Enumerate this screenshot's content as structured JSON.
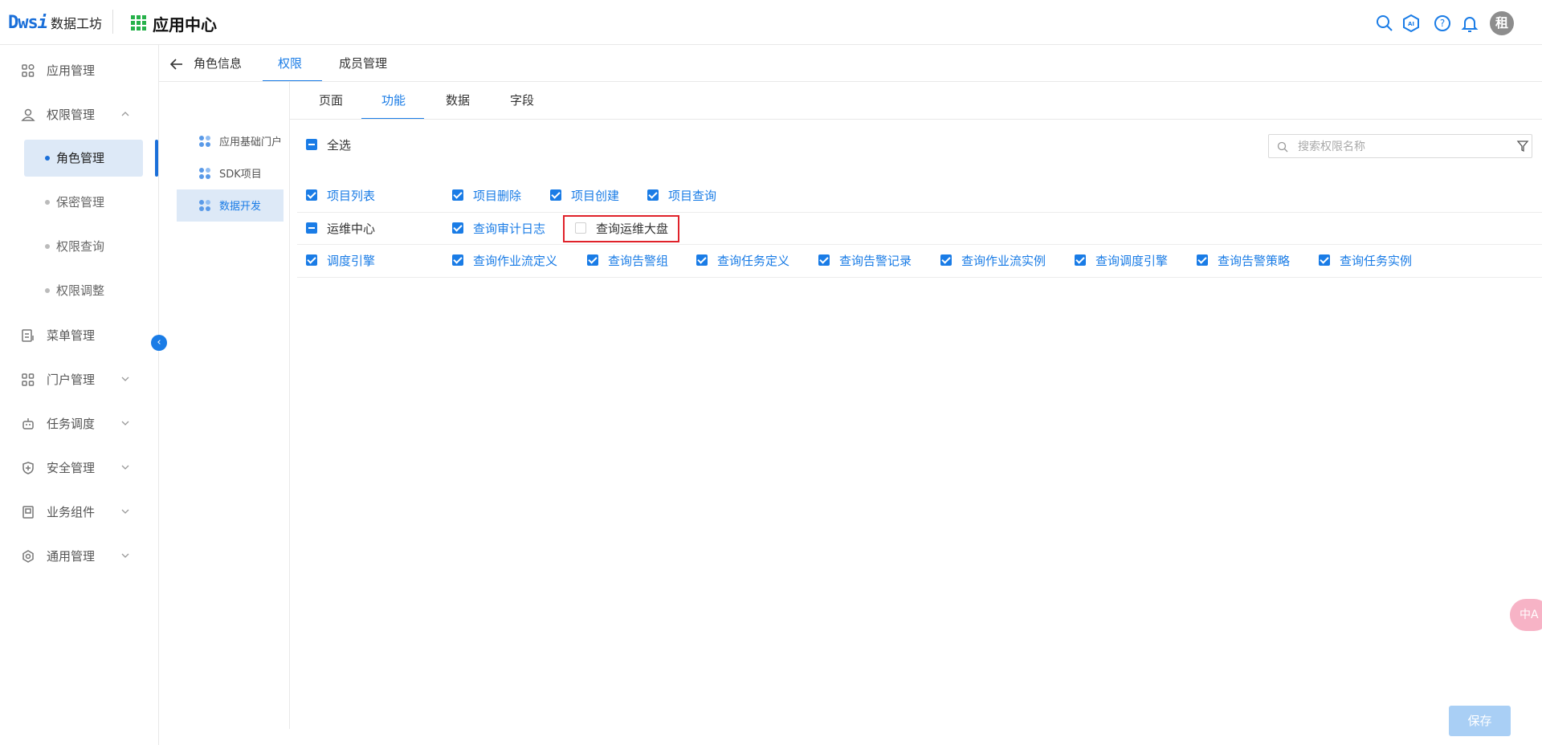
{
  "header": {
    "logo_mark": "Dws",
    "logo_mark_i": "i",
    "logo_text": "数据工坊",
    "app_title": "应用中心",
    "avatar_text": "租"
  },
  "sidebar": {
    "items": [
      {
        "label": "应用管理"
      },
      {
        "label": "权限管理"
      },
      {
        "label": "菜单管理"
      },
      {
        "label": "门户管理"
      },
      {
        "label": "任务调度"
      },
      {
        "label": "安全管理"
      },
      {
        "label": "业务组件"
      },
      {
        "label": "通用管理"
      }
    ],
    "sub_items": [
      {
        "label": "角色管理"
      },
      {
        "label": "保密管理"
      },
      {
        "label": "权限查询"
      },
      {
        "label": "权限调整"
      }
    ]
  },
  "top_tabs": [
    "角色信息",
    "权限",
    "成员管理"
  ],
  "tree": [
    "应用基础门户",
    "SDK项目",
    "数据开发"
  ],
  "sub_tabs": [
    "页面",
    "功能",
    "数据",
    "字段"
  ],
  "select_all": "全选",
  "search": {
    "placeholder": "搜索权限名称"
  },
  "rows": [
    {
      "group": "项目列表",
      "items": [
        "项目删除",
        "项目创建",
        "项目查询"
      ]
    },
    {
      "group": "运维中心",
      "items": [
        "查询审计日志",
        "查询运维大盘"
      ]
    },
    {
      "group": "调度引擎",
      "items": [
        "查询作业流定义",
        "查询告警组",
        "查询任务定义",
        "查询告警记录",
        "查询作业流实例",
        "查询调度引擎",
        "查询告警策略",
        "查询任务实例"
      ]
    }
  ],
  "save_label": "保存",
  "translate_label": "中A",
  "colors": {
    "accent": "#1a7ce6",
    "highlight": "#e0222a",
    "active_bg": "#dde9f7"
  }
}
